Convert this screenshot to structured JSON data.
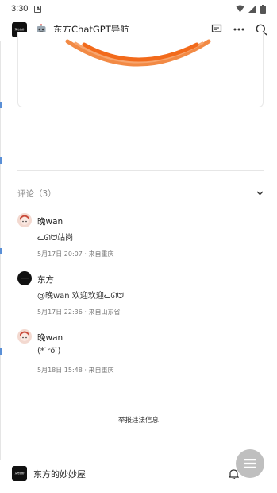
{
  "status_bar": {
    "time": "3:30"
  },
  "header": {
    "title": "东方ChatGPT导航",
    "logo_text": "东方的妙"
  },
  "comments_section": {
    "title": "评论（3）",
    "comments": [
      {
        "name": "晚wan",
        "text": "ᓚᘏᗢ站岗",
        "meta": "5月17日 20:07 · 来自重庆",
        "avatar": "anime-avatar"
      },
      {
        "name": "东方",
        "text": "@晚wan 欢迎欢迎ᓚᘏᗢ",
        "meta": "5月17日 22:36 · 来自山东省",
        "avatar": "logo-avatar"
      },
      {
        "name": "晚wan",
        "text": "(* ̄rō ̄)",
        "meta": "5月18日 15:48 · 来自重庆",
        "avatar": "anime-avatar"
      }
    ]
  },
  "report": {
    "label": "举报违法信息"
  },
  "bottom_bar": {
    "name": "东方的妙妙屋"
  },
  "colors": {
    "accent_orange": "#f26a1b",
    "text": "#222222",
    "muted": "#8a8a8a"
  }
}
